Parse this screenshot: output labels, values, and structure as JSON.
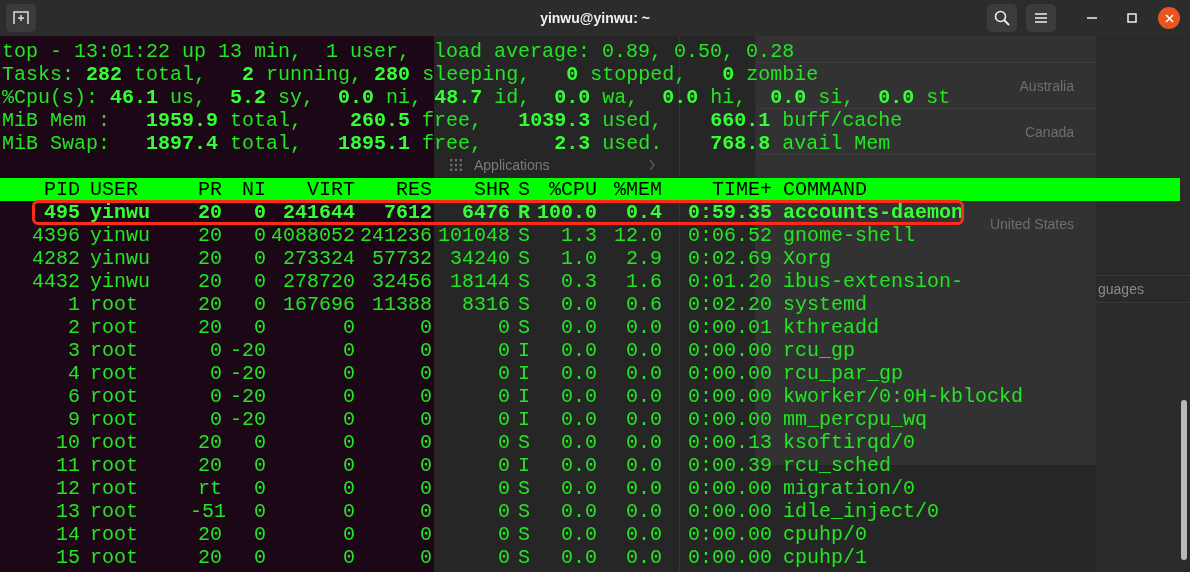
{
  "window": {
    "title": "yinwu@yinwu: ~"
  },
  "summary_lines": [
    "top - 13:01:22 up 13 min,  1 user,  load average: 0.89, 0.50, 0.28",
    "Tasks: **282** total,   **2** running, **280** sleeping,   **0** stopped,   **0** zombie",
    "%Cpu(s): **46.1** us,  **5.2** sy,  **0.0** ni, **48.7** id,  **0.0** wa,  **0.0** hi,  **0.0** si,  **0.0** st",
    "MiB Mem :   **1959.9** total,    **260.5** free,   **1039.3** used,    **660.1** buff/cache",
    "MiB Swap:   **1897.4** total,   **1895.1** free,      **2.3** used.    **768.8** avail Mem"
  ],
  "process_table": {
    "columns": [
      "PID",
      "USER",
      "PR",
      "NI",
      "VIRT",
      "RES",
      "SHR",
      "S",
      "%CPU",
      "%MEM",
      "TIME+",
      "COMMAND"
    ],
    "rows": [
      {
        "highlighted": true,
        "cells": [
          "495",
          "yinwu",
          "20",
          "0",
          "241644",
          "7612",
          "6476",
          "R",
          "100.0",
          "0.4",
          "0:59.35",
          "accounts-daemon"
        ]
      },
      {
        "highlighted": false,
        "cells": [
          "4396",
          "yinwu",
          "20",
          "0",
          "4088052",
          "241236",
          "101048",
          "S",
          "1.3",
          "12.0",
          "0:06.52",
          "gnome-shell"
        ]
      },
      {
        "highlighted": false,
        "cells": [
          "4282",
          "yinwu",
          "20",
          "0",
          "273324",
          "57732",
          "34240",
          "S",
          "1.0",
          "2.9",
          "0:02.69",
          "Xorg"
        ]
      },
      {
        "highlighted": false,
        "cells": [
          "4432",
          "yinwu",
          "20",
          "0",
          "278720",
          "32456",
          "18144",
          "S",
          "0.3",
          "1.6",
          "0:01.20",
          "ibus-extension-"
        ]
      },
      {
        "highlighted": false,
        "cells": [
          "1",
          "root",
          "20",
          "0",
          "167696",
          "11388",
          "8316",
          "S",
          "0.0",
          "0.6",
          "0:02.20",
          "systemd"
        ]
      },
      {
        "highlighted": false,
        "cells": [
          "2",
          "root",
          "20",
          "0",
          "0",
          "0",
          "0",
          "S",
          "0.0",
          "0.0",
          "0:00.01",
          "kthreadd"
        ]
      },
      {
        "highlighted": false,
        "cells": [
          "3",
          "root",
          "0",
          "-20",
          "0",
          "0",
          "0",
          "I",
          "0.0",
          "0.0",
          "0:00.00",
          "rcu_gp"
        ]
      },
      {
        "highlighted": false,
        "cells": [
          "4",
          "root",
          "0",
          "-20",
          "0",
          "0",
          "0",
          "I",
          "0.0",
          "0.0",
          "0:00.00",
          "rcu_par_gp"
        ]
      },
      {
        "highlighted": false,
        "cells": [
          "6",
          "root",
          "0",
          "-20",
          "0",
          "0",
          "0",
          "I",
          "0.0",
          "0.0",
          "0:00.00",
          "kworker/0:0H-kblockd"
        ]
      },
      {
        "highlighted": false,
        "cells": [
          "9",
          "root",
          "0",
          "-20",
          "0",
          "0",
          "0",
          "I",
          "0.0",
          "0.0",
          "0:00.00",
          "mm_percpu_wq"
        ]
      },
      {
        "highlighted": false,
        "cells": [
          "10",
          "root",
          "20",
          "0",
          "0",
          "0",
          "0",
          "S",
          "0.0",
          "0.0",
          "0:00.13",
          "ksoftirqd/0"
        ]
      },
      {
        "highlighted": false,
        "cells": [
          "11",
          "root",
          "20",
          "0",
          "0",
          "0",
          "0",
          "I",
          "0.0",
          "0.0",
          "0:00.39",
          "rcu_sched"
        ]
      },
      {
        "highlighted": false,
        "cells": [
          "12",
          "root",
          "rt",
          "0",
          "0",
          "0",
          "0",
          "S",
          "0.0",
          "0.0",
          "0:00.00",
          "migration/0"
        ]
      },
      {
        "highlighted": false,
        "cells": [
          "13",
          "root",
          "-51",
          "0",
          "0",
          "0",
          "0",
          "S",
          "0.0",
          "0.0",
          "0:00.00",
          "idle_inject/0"
        ]
      },
      {
        "highlighted": false,
        "cells": [
          "14",
          "root",
          "20",
          "0",
          "0",
          "0",
          "0",
          "S",
          "0.0",
          "0.0",
          "0:00.00",
          "cpuhp/0"
        ]
      },
      {
        "highlighted": false,
        "cells": [
          "15",
          "root",
          "20",
          "0",
          "0",
          "0",
          "0",
          "S",
          "0.0",
          "0.0",
          "0:00.00",
          "cpuhp/1"
        ]
      }
    ]
  },
  "background_window": {
    "sidebar_items": [
      {
        "label": "Applications"
      }
    ],
    "regions": [
      "Australia",
      "Canada",
      "United States"
    ],
    "side_label": "guages"
  }
}
